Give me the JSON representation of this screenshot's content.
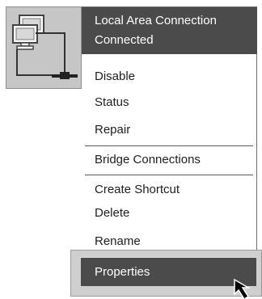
{
  "icon": {
    "name": "network-connection-icon"
  },
  "header": {
    "title": "Local Area Connection",
    "status": "Connected"
  },
  "menu": {
    "disable": "Disable",
    "status": "Status",
    "repair": "Repair",
    "bridge": "Bridge Connections",
    "create_shortcut": "Create Shortcut",
    "delete": "Delete",
    "rename": "Rename",
    "properties": "Properties"
  },
  "colors": {
    "highlight": "#4b4b4b",
    "menu_bg": "#ffffff",
    "icon_tile": "#c6c6c6"
  }
}
